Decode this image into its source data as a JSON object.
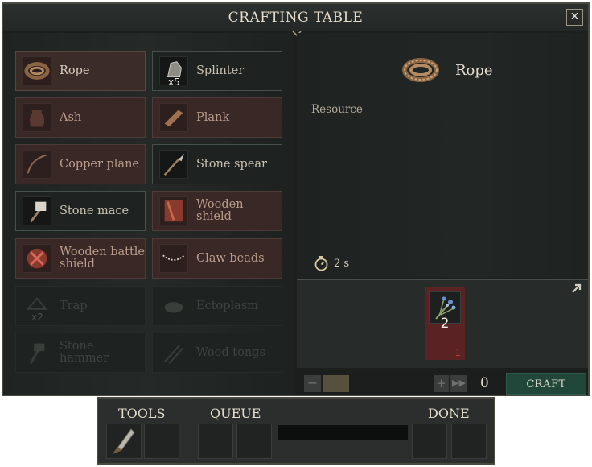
{
  "window": {
    "title": "CRAFTING TABLE",
    "close_label": "✕"
  },
  "recipes": [
    {
      "label": "Rope",
      "icon": "rope-icon",
      "state": "selected",
      "qty": ""
    },
    {
      "label": "Splinter",
      "icon": "splinter-icon",
      "state": "craftable",
      "qty": "x5"
    },
    {
      "label": "Ash",
      "icon": "ash-pot-icon",
      "state": "owned",
      "qty": ""
    },
    {
      "label": "Plank",
      "icon": "plank-icon",
      "state": "owned",
      "qty": ""
    },
    {
      "label": "Copper plane",
      "icon": "copper-plane-icon",
      "state": "owned",
      "qty": ""
    },
    {
      "label": "Stone spear",
      "icon": "stone-spear-icon",
      "state": "craftable",
      "qty": ""
    },
    {
      "label": "Stone mace",
      "icon": "stone-mace-icon",
      "state": "craftable",
      "qty": ""
    },
    {
      "label": "Wooden shield",
      "icon": "wooden-shield-icon",
      "state": "owned",
      "qty": ""
    },
    {
      "label": "Wooden battle shield",
      "icon": "wooden-battle-shield-icon",
      "state": "owned",
      "qty": ""
    },
    {
      "label": "Claw beads",
      "icon": "claw-beads-icon",
      "state": "owned",
      "qty": ""
    },
    {
      "label": "Trap",
      "icon": "trap-icon",
      "state": "locked",
      "qty": "x2"
    },
    {
      "label": "Ectoplasm",
      "icon": "ectoplasm-icon",
      "state": "locked",
      "qty": ""
    },
    {
      "label": "Stone hammer",
      "icon": "stone-hammer-icon",
      "state": "locked",
      "qty": ""
    },
    {
      "label": "Wood tongs",
      "icon": "wood-tongs-icon",
      "state": "locked",
      "qty": ""
    }
  ],
  "detail": {
    "name": "Rope",
    "icon": "rope-icon",
    "type": "Resource",
    "time": "2 s"
  },
  "ingredient": {
    "icon": "herb-fiber-icon",
    "required": "2",
    "have": "1"
  },
  "controls": {
    "minus": "−",
    "plus": "+",
    "max": "▶▶",
    "count": "0",
    "craft_label": "CRAFT"
  },
  "queue": {
    "tools_label": "TOOLS",
    "queue_label": "QUEUE",
    "done_label": "DONE",
    "tool_icon": "stone-knife-icon"
  },
  "colors": {
    "accent_red": "#5a2222",
    "craft_green": "#21463a",
    "border": "#4a4a42"
  }
}
